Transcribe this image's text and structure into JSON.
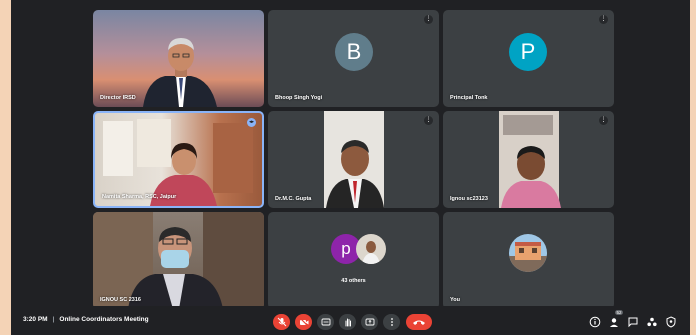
{
  "tiles": [
    {
      "name": "Director IRSD"
    },
    {
      "name": "Bhoop Singh Yogi",
      "initial": "B",
      "avatar_color": "#607d8b"
    },
    {
      "name": "Principal Tonk",
      "initial": "P",
      "avatar_color": "#00a3c4"
    },
    {
      "name": "Namita Sharma, RSC, Jaipur"
    },
    {
      "name": "Dr.M.C. Gupta"
    },
    {
      "name": "Ignou sc23123"
    },
    {
      "name": "IGNOU SC 2316"
    },
    {
      "name": "43 others",
      "initial": "p",
      "avatar_color": "#8e24aa"
    },
    {
      "name": "You"
    }
  ],
  "bottom_bar": {
    "time": "3:20 PM",
    "separator": "|",
    "meeting_title": "Online Coordinators Meeting",
    "participants_badge": "52"
  },
  "colors": {
    "meet_bg": "#202124",
    "tile_bg": "#3c4043",
    "end_call": "#ea4335",
    "active_speaker_border": "#8ab4f8"
  }
}
